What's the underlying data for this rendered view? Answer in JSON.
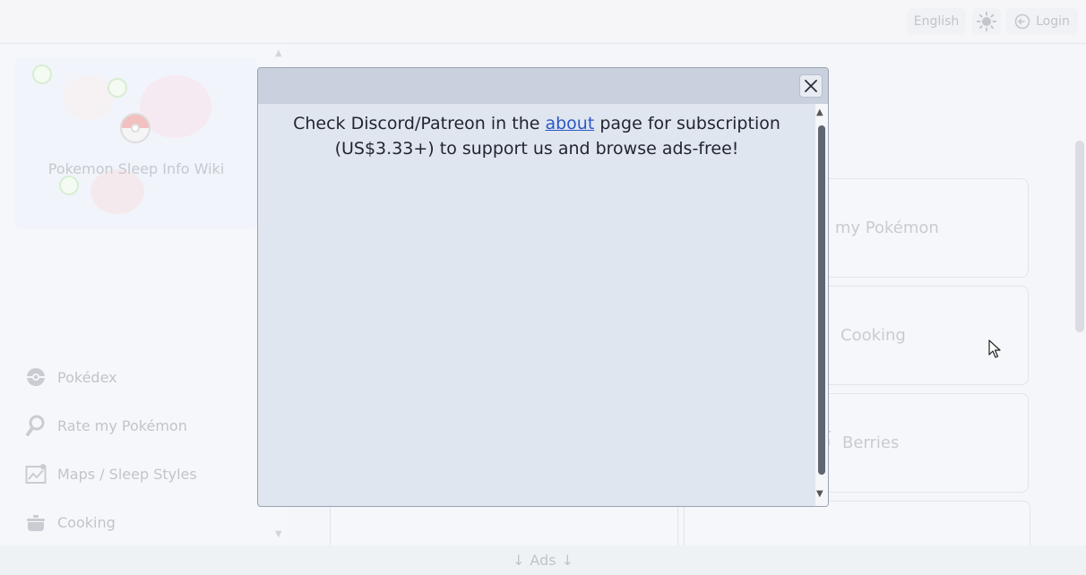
{
  "topbar": {
    "language_label": "English",
    "theme_icon": "sun-icon",
    "login_label": "Login",
    "login_icon": "login-arrow-icon"
  },
  "sidebar": {
    "hero_title": "Pokemon Sleep Info Wiki",
    "items": [
      {
        "label": "Pokédex",
        "icon": "pokeball-icon"
      },
      {
        "label": "Rate my Pokémon",
        "icon": "magnifier-icon"
      },
      {
        "label": "Maps / Sleep Styles",
        "icon": "map-chart-icon"
      },
      {
        "label": "Cooking",
        "icon": "pot-icon"
      }
    ]
  },
  "main": {
    "cards": [
      {
        "label": "te my Pokémon"
      },
      {
        "label": "Cooking",
        "icon": "pot-icon"
      },
      {
        "label": "Berries",
        "icon": "berry-icon"
      }
    ]
  },
  "ads_bar": {
    "label": "Ads",
    "icon": "arrow-down-icon"
  },
  "dialog": {
    "text_before": "Check Discord/Patreon in the ",
    "link_text": "about",
    "text_after": " page for subscription (US$3.33+) to support us and browse ads-free!",
    "close_icon": "close-icon"
  },
  "colors": {
    "dialog_bg": "#e0e6ef",
    "dialog_header": "#c9d1de",
    "link": "#2b57c7",
    "muted_text": "#b3b8c0"
  }
}
